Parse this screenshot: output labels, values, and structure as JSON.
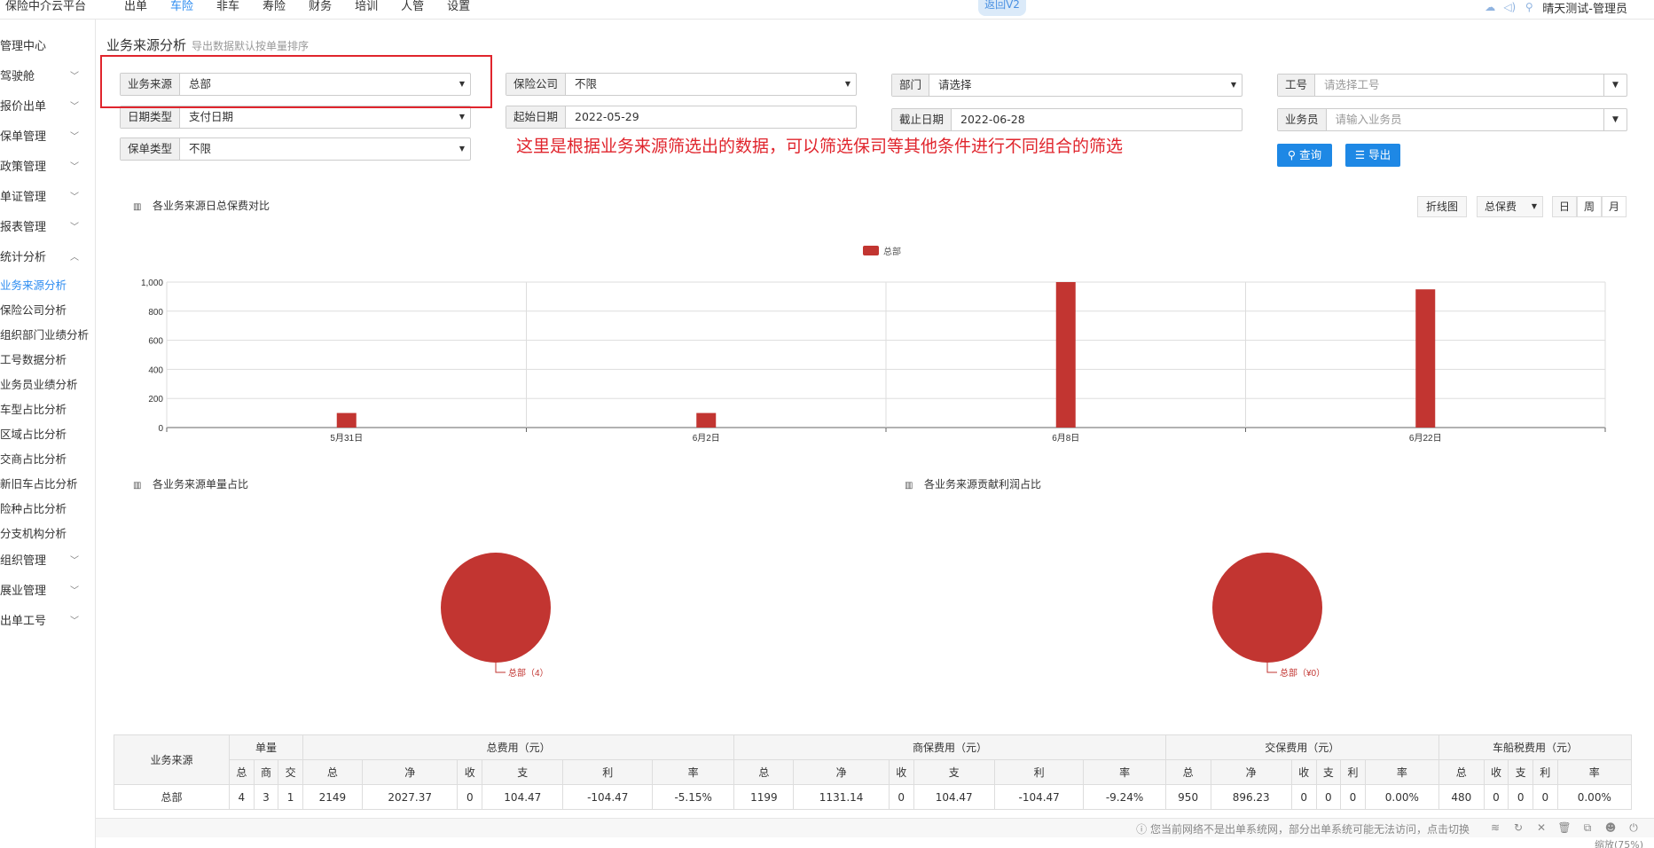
{
  "topbar": {
    "brand": "保险中介云平台",
    "nav": [
      "出单",
      "车险",
      "非车",
      "寿险",
      "财务",
      "培训",
      "人管",
      "设置"
    ],
    "active": "车险",
    "back_button": "返回V2",
    "user": "晴天测试-管理员"
  },
  "sidebar": {
    "items": [
      {
        "label": "管理中心",
        "chevron": ""
      },
      {
        "label": "驾驶舱",
        "chevron": "﹀"
      },
      {
        "label": "报价出单",
        "chevron": "﹀"
      },
      {
        "label": "保单管理",
        "chevron": "﹀"
      },
      {
        "label": "政策管理",
        "chevron": "﹀"
      },
      {
        "label": "单证管理",
        "chevron": "﹀"
      },
      {
        "label": "报表管理",
        "chevron": "﹀"
      },
      {
        "label": "统计分析",
        "chevron": "︿"
      }
    ],
    "sub_items": [
      "业务来源分析",
      "保险公司分析",
      "组织部门业绩分析",
      "工号数据分析",
      "业务员业绩分析",
      "车型占比分析",
      "区域占比分析",
      "交商占比分析",
      "新旧车占比分析",
      "险种占比分析",
      "分支机构分析"
    ],
    "items_after": [
      {
        "label": "组织管理",
        "chevron": "﹀"
      },
      {
        "label": "展业管理",
        "chevron": "﹀"
      },
      {
        "label": "出单工号",
        "chevron": "﹀"
      }
    ]
  },
  "page": {
    "title": "业务来源分析",
    "subtitle": "导出数据默认按单量排序"
  },
  "filters": {
    "source": {
      "label": "业务来源",
      "value": "总部"
    },
    "insurer": {
      "label": "保险公司",
      "value": "不限"
    },
    "dept": {
      "label": "部门",
      "placeholder": "请选择"
    },
    "worknum": {
      "label": "工号",
      "placeholder": "请选择工号"
    },
    "date_type": {
      "label": "日期类型",
      "value": "支付日期"
    },
    "start_date": {
      "label": "起始日期",
      "value": "2022-05-29"
    },
    "end_date": {
      "label": "截止日期",
      "value": "2022-06-28"
    },
    "salesman": {
      "label": "业务员",
      "placeholder": "请输入业务员"
    },
    "policy_type": {
      "label": "保单类型",
      "value": "不限"
    }
  },
  "annotation": "这里是根据业务来源筛选出的数据，可以筛选保司等其他条件进行不同组合的筛选",
  "buttons": {
    "query": "查询",
    "export": "导出"
  },
  "chart_controls": {
    "chart_type": "折线图",
    "metric": "总保费",
    "day": "日",
    "week": "周",
    "month": "月"
  },
  "sections": {
    "daily": "各业务来源日总保费对比",
    "count_share": "各业务来源单量占比",
    "profit_share": "各业务来源贡献利润占比"
  },
  "chart_data": [
    {
      "type": "bar",
      "title": "各业务来源日总保费对比",
      "categories": [
        "5月31日",
        "6月2日",
        "6月8日",
        "6月22日"
      ],
      "series": [
        {
          "name": "总部",
          "values": [
            100,
            100,
            1000,
            950
          ],
          "color": "#c23531"
        }
      ],
      "ylim": [
        0,
        1000
      ],
      "yticks": [
        "0",
        "200",
        "400",
        "600",
        "800",
        "1,000"
      ],
      "legend": "top-center",
      "grid": true
    },
    {
      "type": "pie",
      "title": "各业务来源单量占比",
      "slices": [
        {
          "name": "总部",
          "value": 4,
          "label": "总部（4）",
          "color": "#c23531"
        }
      ]
    },
    {
      "type": "pie",
      "title": "各业务来源贡献利润占比",
      "slices": [
        {
          "name": "总部",
          "value": 0,
          "label": "总部（¥0）",
          "color": "#c23531"
        }
      ]
    }
  ],
  "table": {
    "header_row1": [
      "业务来源",
      "单量",
      "总费用（元）",
      "商保费用（元）",
      "交保费用（元）",
      "车船税费用（元）"
    ],
    "header_row2": [
      "总",
      "商",
      "交",
      "总",
      "净",
      "收",
      "支",
      "利",
      "率",
      "总",
      "净",
      "收",
      "支",
      "利",
      "率",
      "总",
      "净",
      "收",
      "支",
      "利",
      "率",
      "总",
      "收",
      "支",
      "利",
      "率"
    ],
    "rows": [
      [
        "总部",
        "4",
        "3",
        "1",
        "2149",
        "2027.37",
        "0",
        "104.47",
        "-104.47",
        "-5.15%",
        "1199",
        "1131.14",
        "0",
        "104.47",
        "-104.47",
        "-9.24%",
        "950",
        "896.23",
        "0",
        "0",
        "0",
        "0.00%",
        "480",
        "0",
        "0",
        "0",
        "0.00%"
      ]
    ]
  },
  "statusbar": {
    "message": "您当前网络不是出单系统网，部分出单系统可能无法访问，点击切换"
  },
  "bottombar": {
    "zoom": "缩放(75%)"
  }
}
